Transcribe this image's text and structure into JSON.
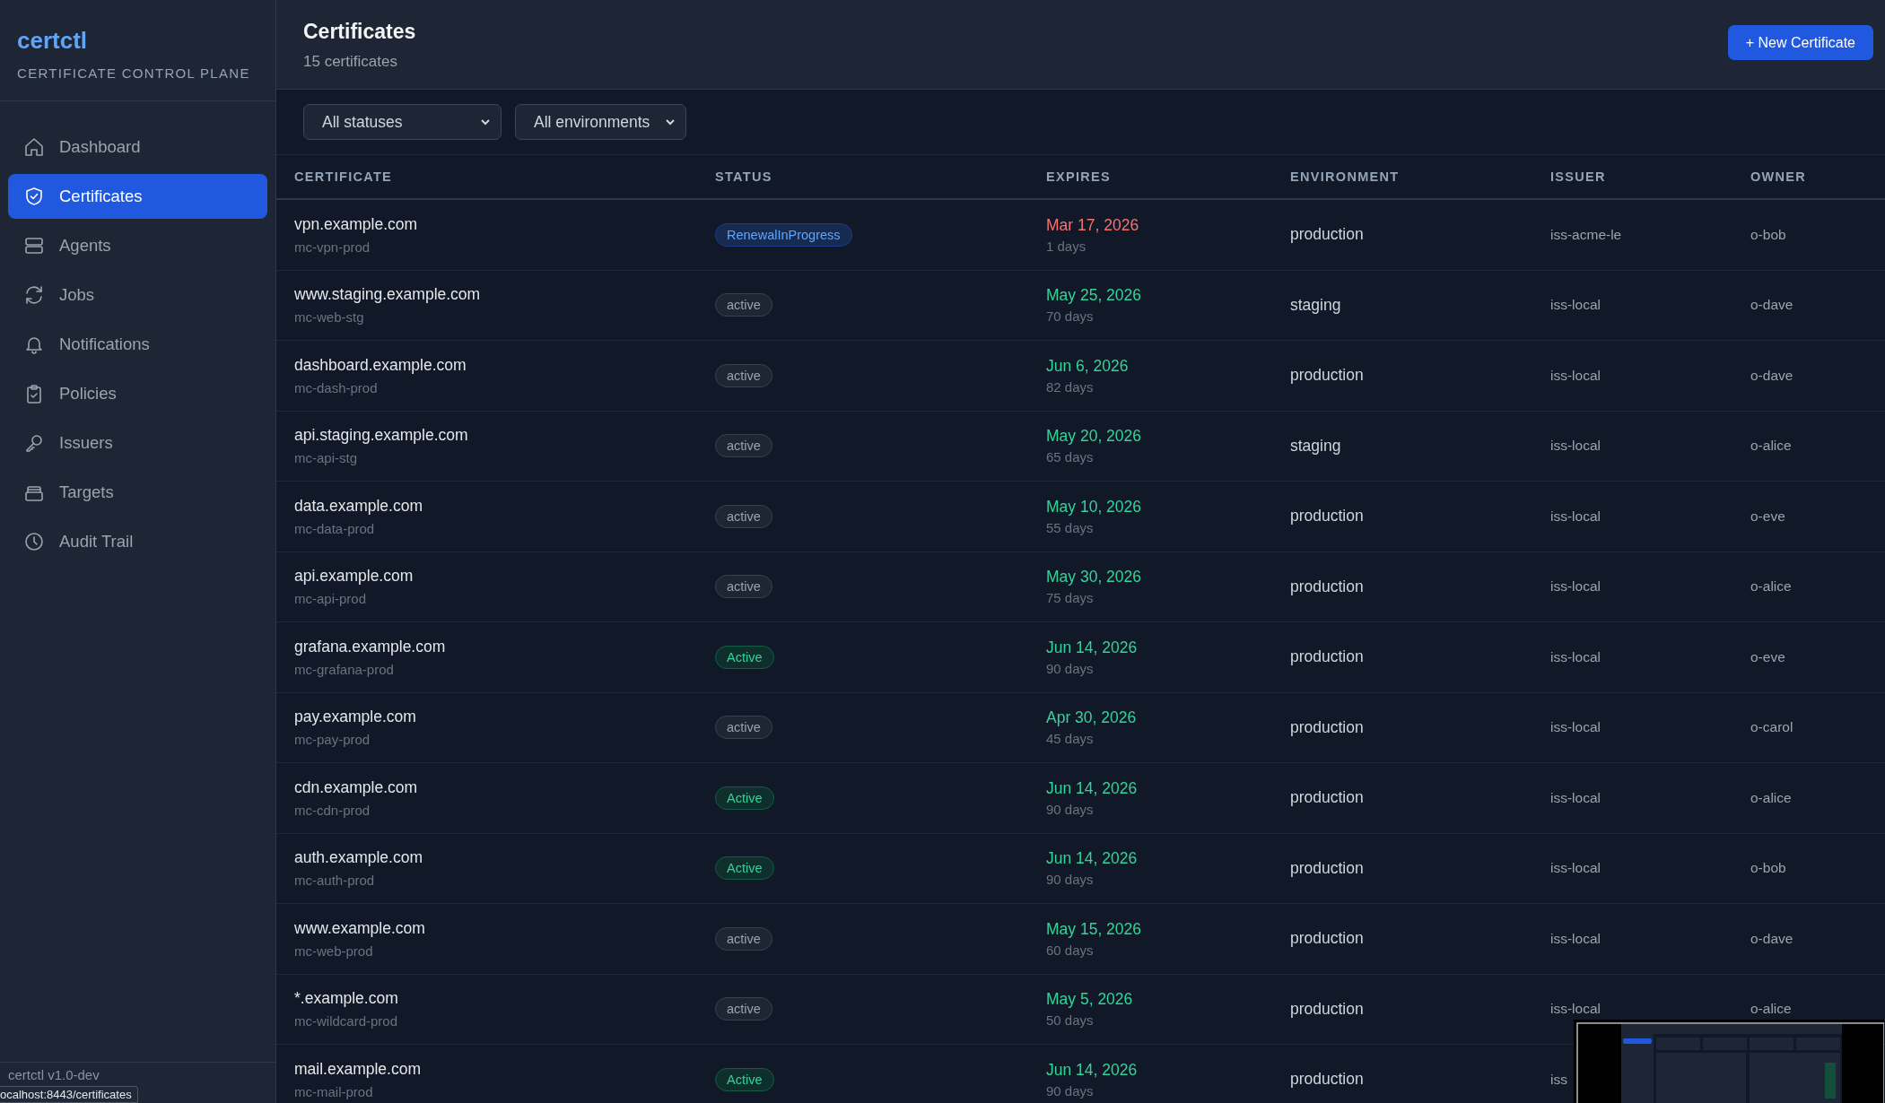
{
  "sidebar": {
    "brand": "certctl",
    "tagline": "CERTIFICATE CONTROL PLANE",
    "nav": [
      {
        "label": "Dashboard",
        "selected": false
      },
      {
        "label": "Certificates",
        "selected": true
      },
      {
        "label": "Agents",
        "selected": false
      },
      {
        "label": "Jobs",
        "selected": false
      },
      {
        "label": "Notifications",
        "selected": false
      },
      {
        "label": "Policies",
        "selected": false
      },
      {
        "label": "Issuers",
        "selected": false
      },
      {
        "label": "Targets",
        "selected": false
      },
      {
        "label": "Audit Trail",
        "selected": false
      }
    ],
    "footer": "certctl v1.0-dev"
  },
  "header": {
    "title": "Certificates",
    "subtitle": "15 certificates",
    "button": "+ New Certificate"
  },
  "filters": [
    {
      "value": "All statuses"
    },
    {
      "value": "All environments"
    }
  ],
  "table": {
    "columns": [
      "CERTIFICATE",
      "STATUS",
      "EXPIRES",
      "ENVIRONMENT",
      "ISSUER",
      "OWNER"
    ],
    "rows": [
      {
        "name": "vpn.example.com",
        "id": "mc-vpn-prod",
        "status": {
          "text": "RenewalInProgress",
          "kind": "renewing"
        },
        "expires": "Mar 17, 2026",
        "remaining": "1 days",
        "critical": true,
        "environment": "production",
        "issuer": "iss-acme-le",
        "owner": "o-bob"
      },
      {
        "name": "www.staging.example.com",
        "id": "mc-web-stg",
        "status": {
          "text": "active",
          "kind": "plain"
        },
        "expires": "May 25, 2026",
        "remaining": "70 days",
        "critical": false,
        "environment": "staging",
        "issuer": "iss-local",
        "owner": "o-dave"
      },
      {
        "name": "dashboard.example.com",
        "id": "mc-dash-prod",
        "status": {
          "text": "active",
          "kind": "plain"
        },
        "expires": "Jun 6, 2026",
        "remaining": "82 days",
        "critical": false,
        "environment": "production",
        "issuer": "iss-local",
        "owner": "o-dave"
      },
      {
        "name": "api.staging.example.com",
        "id": "mc-api-stg",
        "status": {
          "text": "active",
          "kind": "plain"
        },
        "expires": "May 20, 2026",
        "remaining": "65 days",
        "critical": false,
        "environment": "staging",
        "issuer": "iss-local",
        "owner": "o-alice"
      },
      {
        "name": "data.example.com",
        "id": "mc-data-prod",
        "status": {
          "text": "active",
          "kind": "plain"
        },
        "expires": "May 10, 2026",
        "remaining": "55 days",
        "critical": false,
        "environment": "production",
        "issuer": "iss-local",
        "owner": "o-eve"
      },
      {
        "name": "api.example.com",
        "id": "mc-api-prod",
        "status": {
          "text": "active",
          "kind": "plain"
        },
        "expires": "May 30, 2026",
        "remaining": "75 days",
        "critical": false,
        "environment": "production",
        "issuer": "iss-local",
        "owner": "o-alice"
      },
      {
        "name": "grafana.example.com",
        "id": "mc-grafana-prod",
        "status": {
          "text": "Active",
          "kind": "success"
        },
        "expires": "Jun 14, 2026",
        "remaining": "90 days",
        "critical": false,
        "environment": "production",
        "issuer": "iss-local",
        "owner": "o-eve"
      },
      {
        "name": "pay.example.com",
        "id": "mc-pay-prod",
        "status": {
          "text": "active",
          "kind": "plain"
        },
        "expires": "Apr 30, 2026",
        "remaining": "45 days",
        "critical": false,
        "environment": "production",
        "issuer": "iss-local",
        "owner": "o-carol"
      },
      {
        "name": "cdn.example.com",
        "id": "mc-cdn-prod",
        "status": {
          "text": "Active",
          "kind": "success"
        },
        "expires": "Jun 14, 2026",
        "remaining": "90 days",
        "critical": false,
        "environment": "production",
        "issuer": "iss-local",
        "owner": "o-alice"
      },
      {
        "name": "auth.example.com",
        "id": "mc-auth-prod",
        "status": {
          "text": "Active",
          "kind": "success"
        },
        "expires": "Jun 14, 2026",
        "remaining": "90 days",
        "critical": false,
        "environment": "production",
        "issuer": "iss-local",
        "owner": "o-bob"
      },
      {
        "name": "www.example.com",
        "id": "mc-web-prod",
        "status": {
          "text": "active",
          "kind": "plain"
        },
        "expires": "May 15, 2026",
        "remaining": "60 days",
        "critical": false,
        "environment": "production",
        "issuer": "iss-local",
        "owner": "o-dave"
      },
      {
        "name": "*.example.com",
        "id": "mc-wildcard-prod",
        "status": {
          "text": "active",
          "kind": "plain"
        },
        "expires": "May 5, 2026",
        "remaining": "50 days",
        "critical": false,
        "environment": "production",
        "issuer": "iss-local",
        "owner": "o-alice"
      },
      {
        "name": "mail.example.com",
        "id": "mc-mail-prod",
        "status": {
          "text": "Active",
          "kind": "success"
        },
        "expires": "Jun 14, 2026",
        "remaining": "90 days",
        "critical": false,
        "environment": "production",
        "issuer": "iss"
      }
    ]
  },
  "link_preview": "ocalhost:8443/certificates"
}
